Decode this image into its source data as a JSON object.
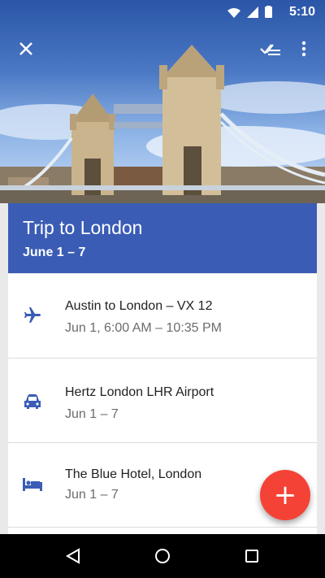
{
  "status_bar": {
    "time": "5:10"
  },
  "hero": {
    "close_icon": "close-icon",
    "done_all_icon": "done-all-icon",
    "more_icon": "more-vert-icon"
  },
  "trip": {
    "title": "Trip to London",
    "dates": "June 1 – 7"
  },
  "items": [
    {
      "icon": "airplane-icon",
      "title": "Austin to London – VX 12",
      "subtitle": "Jun 1, 6:00 AM – 10:35 PM"
    },
    {
      "icon": "car-icon",
      "title": "Hertz London LHR Airport",
      "subtitle": "Jun 1 – 7"
    },
    {
      "icon": "hotel-icon",
      "title": "The Blue Hotel, London",
      "subtitle": "Jun 1 – 7"
    }
  ],
  "fab": {
    "icon": "plus-icon",
    "label": "+"
  },
  "colors": {
    "accent": "#3a5cb5",
    "fab": "#f44336",
    "icon_blue": "#3a5cb5"
  }
}
